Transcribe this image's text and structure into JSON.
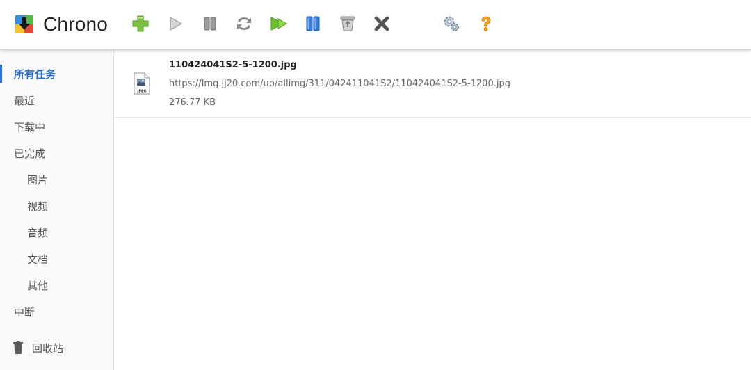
{
  "app": {
    "name": "Chrono"
  },
  "toolbar": {
    "items": [
      {
        "name": "add-icon",
        "color": "#7ac142"
      },
      {
        "name": "play-icon",
        "color": "#a8a8a8"
      },
      {
        "name": "pause-icon",
        "color": "#8a8a8a"
      },
      {
        "name": "refresh-icon",
        "color": "#8a8a8a"
      },
      {
        "name": "start-all-icon",
        "color": "#6abf2b"
      },
      {
        "name": "pause-all-icon",
        "color": "#3a7bd5"
      },
      {
        "name": "clear-completed-icon",
        "color": "#9a9a9a"
      },
      {
        "name": "delete-icon",
        "color": "#555555"
      },
      {
        "name": "settings-icon",
        "color": "#8aa0b8"
      },
      {
        "name": "help-icon",
        "color": "#f0a020"
      }
    ]
  },
  "sidebar": {
    "accent": "#2a6fd6",
    "items": [
      {
        "label": "所有任务",
        "active": true
      },
      {
        "label": "最近"
      },
      {
        "label": "下载中"
      },
      {
        "label": "已完成"
      },
      {
        "label": "图片",
        "sub": true
      },
      {
        "label": "视频",
        "sub": true
      },
      {
        "label": "音频",
        "sub": true
      },
      {
        "label": "文档",
        "sub": true
      },
      {
        "label": "其他",
        "sub": true
      },
      {
        "label": "中断"
      }
    ],
    "trash": {
      "label": "回收站",
      "icon": "trash-icon"
    }
  },
  "downloads": [
    {
      "file_name": "110424041S2-5-1200.jpg",
      "url": "https://Img.jj20.com/up/allimg/311/042411041S2/110424041S2-5-1200.jpg",
      "size": "276.77 KB",
      "icon": "jpeg-file-icon",
      "icon_label": "JPEG"
    }
  ]
}
